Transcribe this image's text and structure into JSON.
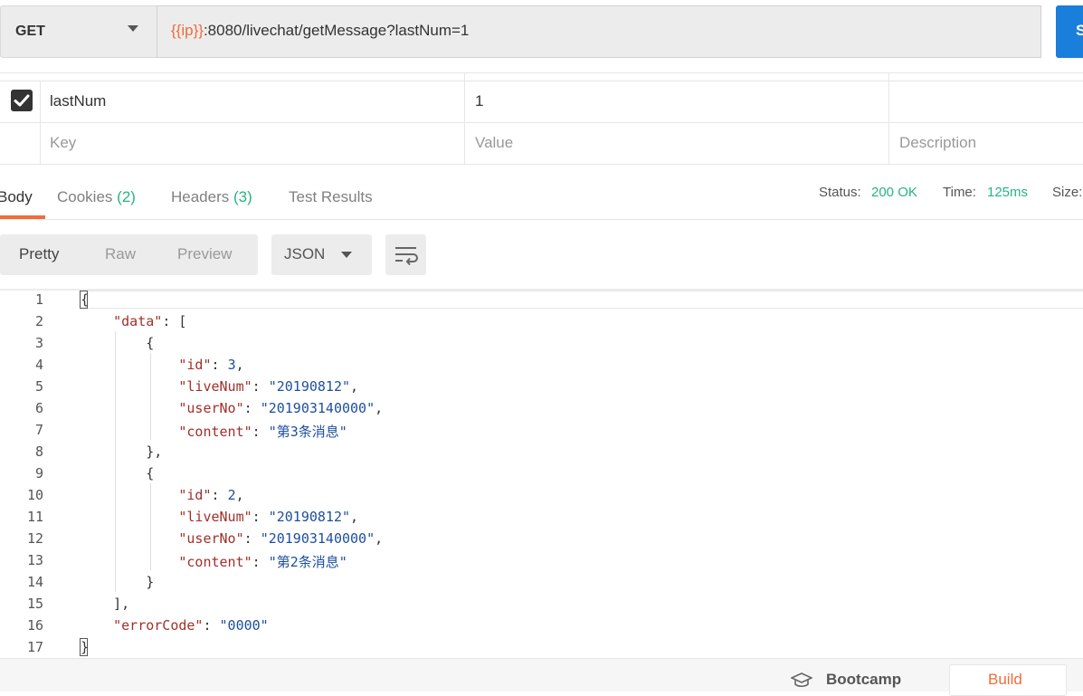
{
  "request": {
    "method": "GET",
    "url_var": "{{ip}}",
    "url_rest": ":8080/livechat/getMessage?lastNum=1",
    "send_label": "S"
  },
  "params": {
    "rows": [
      {
        "checked": true,
        "key": "lastNum",
        "value": "1",
        "description": ""
      }
    ],
    "placeholders": {
      "key": "Key",
      "value": "Value",
      "description": "Description"
    }
  },
  "response": {
    "tabs": [
      {
        "label": "Body",
        "count": ""
      },
      {
        "label": "Cookies",
        "count": "(2)"
      },
      {
        "label": "Headers",
        "count": "(3)"
      },
      {
        "label": "Test Results",
        "count": ""
      }
    ],
    "status_label": "Status:",
    "status_value": "200 OK",
    "time_label": "Time:",
    "time_value": "125ms",
    "size_label": "Size:",
    "view_modes": [
      "Pretty",
      "Raw",
      "Preview"
    ],
    "format": "JSON"
  },
  "code": {
    "line_numbers": [
      "1",
      "2",
      "3",
      "4",
      "5",
      "6",
      "7",
      "8",
      "9",
      "10",
      "11",
      "12",
      "13",
      "14",
      "15",
      "16",
      "17"
    ],
    "lines": [
      "{",
      "    \"data\": [",
      "        {",
      "            \"id\": 3,",
      "            \"liveNum\": \"20190812\",",
      "            \"userNo\": \"201903140000\",",
      "            \"content\": \"第3条消息\"",
      "        },",
      "        {",
      "            \"id\": 2,",
      "            \"liveNum\": \"20190812\",",
      "            \"userNo\": \"201903140000\",",
      "            \"content\": \"第2条消息\"",
      "        }",
      "    ],",
      "    \"errorCode\": \"0000\"",
      "}"
    ]
  },
  "footer": {
    "bootcamp": "Bootcamp",
    "build": "Build"
  },
  "colors": {
    "accent": "#f26b3a",
    "success": "#26b47f",
    "send": "#1a7fdb"
  }
}
